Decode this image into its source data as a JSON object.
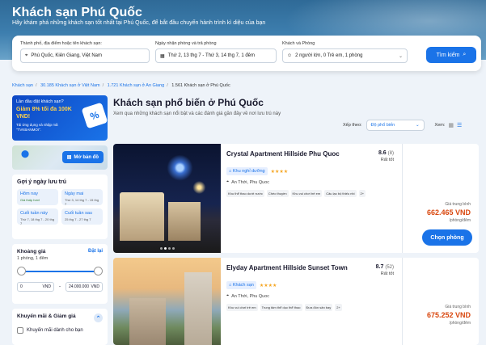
{
  "hero": {
    "title": "Khách sạn Phú Quốc",
    "subtitle": "Hãy khám phá những khách sạn tốt nhất tại Phú Quốc, để bắt đầu chuyến hành trình kì diệu của bạn"
  },
  "search": {
    "destination_label": "Thành phố, địa điểm hoặc tên khách sạn:",
    "destination_value": "Phú Quốc, Kiên Giang, Việt Nam",
    "dates_label": "Ngày nhận phòng và trả phòng",
    "dates_value": "Thứ 2, 13 thg 7 - Thứ 3, 14 thg 7, 1 đêm",
    "guests_label": "Khách và Phòng",
    "guests_value": "2 người lớn, 0 Trẻ em, 1 phòng",
    "button_label": "Tìm kiếm"
  },
  "breadcrumb": {
    "items": [
      "Khách sạn",
      "30.185 Khách sạn ở Việt Nam",
      "1.721 Khách sạn ở An Giang"
    ],
    "current": "1.561 Khách sạn ở Phú Quốc"
  },
  "promo": {
    "line1": "Lần đầu đặt khách sạn?",
    "line2": "Giảm 8% tối đa 100K VND!",
    "line3": "Tải ứng dụng và nhập mã \"TVKBANMOI\"."
  },
  "map": {
    "button_label": "Mở bản đồ"
  },
  "dates_filter": {
    "title": "Gợi ý ngày lưu trú",
    "chips": [
      {
        "label": "Hôm nay",
        "sub": "Giá thấp hơn!"
      },
      {
        "label": "Ngày mai",
        "sub": "Thứ 3, 14 thg 7 - 15 thg 7"
      },
      {
        "label": "Cuối tuần này",
        "sub": "Thứ 7, 18 thg 7 - 20 thg 7"
      },
      {
        "label": "Cuối tuần sau",
        "sub": "25 thg 7 - 27 thg 7"
      }
    ]
  },
  "price_filter": {
    "title": "Khoảng giá",
    "reset": "Đặt lại",
    "subtitle": "1 phòng, 1 đêm",
    "min_value": "0",
    "max_value": "24.000.000",
    "currency": "VND",
    "range_min_fraction": 0,
    "range_max_fraction": 1
  },
  "promo_filter": {
    "title": "Khuyến mãi & Giảm giá",
    "option": "Khuyến mãi dành cho bạn"
  },
  "main": {
    "title": "Khách sạn phổ biến ở Phú Quốc",
    "subtitle": "Xem qua những khách sạn nổi bật và các đánh giá gần đây về nơi lưu trú này",
    "sort_label": "Xếp theo:",
    "sort_value": "Độ phổ biến",
    "view_label": "Xem:"
  },
  "hotels": [
    {
      "name": "Crystal Apartment Hillside Phu Quoc",
      "score": "8.6",
      "reviews": "(8)",
      "rating_word": "Rất tốt",
      "type": "Khu nghỉ dưỡng",
      "stars": "★★★★",
      "location": "An Thới, Phu Quoc",
      "tags": [
        "Khu thể thao dưới nước",
        "Chèo thuyền",
        "Khu vui chơi trẻ em",
        "Câu lạc bộ thiếu nhi",
        "2+"
      ],
      "price_label": "Giá trung bình",
      "price": "662.465 VND",
      "per": "/phòng/đêm",
      "button": "Chọn phòng"
    },
    {
      "name": "Elyday Apartment Hillside Sunset Town",
      "score": "8.7",
      "reviews": "(52)",
      "rating_word": "Rất tốt",
      "type": "Khách sạn",
      "stars": "★★★★",
      "location": "An Thới, Phu Quoc",
      "tags": [
        "Khu vui chơi trẻ em",
        "Trung tâm thể dục thể thao",
        "Đưa đón sân bay",
        "2+"
      ],
      "price_label": "Giá trung bình",
      "price": "675.252 VND",
      "per": "/phòng/đêm"
    }
  ],
  "colors": {
    "accent": "#1a73e8",
    "price": "#d9480f",
    "star": "#f5a623"
  }
}
